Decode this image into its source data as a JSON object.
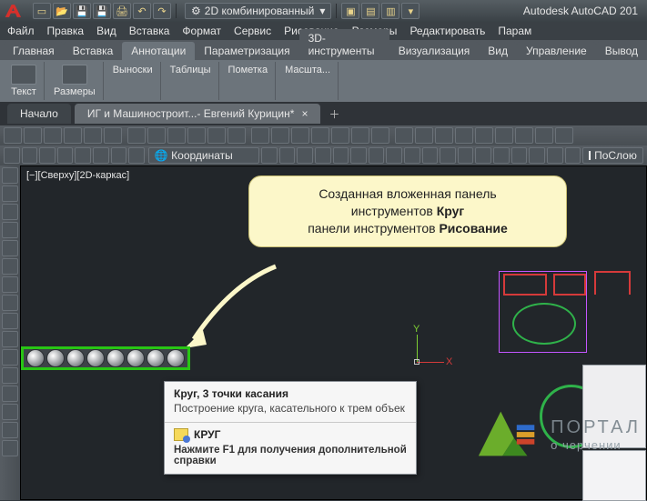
{
  "app_title": "Autodesk AutoCAD 201",
  "workspace_name": "2D комбинированный",
  "menu": [
    "Файл",
    "Правка",
    "Вид",
    "Вставка",
    "Формат",
    "Сервис",
    "Рисование",
    "Размеры",
    "Редактировать",
    "Парам"
  ],
  "ribbon_tabs": [
    "Главная",
    "Вставка",
    "Аннотации",
    "Параметризация",
    "3D-инструменты",
    "Визуализация",
    "Вид",
    "Управление",
    "Вывод"
  ],
  "ribbon_active_index": 2,
  "ribbon_panels": [
    "Текст",
    "Размеры",
    "Выноски",
    "Таблицы",
    "Пометка",
    "Масшта..."
  ],
  "file_tabs": {
    "home": "Начало",
    "doc": "ИГ и Машиностроит...- Евгений Курицин*"
  },
  "coord_label": "Координаты",
  "layer_dropdown": "ПоСлою",
  "view_label": "[−][Сверху][2D-каркас]",
  "axes": {
    "x": "X",
    "y": "Y"
  },
  "callout": {
    "line1": "Созданная вложенная панель",
    "line2_a": "инструментов ",
    "line2_b": "Круг",
    "line3_a": "панели инструментов ",
    "line3_b": "Рисование"
  },
  "tooltip": {
    "title": "Круг, 3 точки касания",
    "desc": "Построение круга, касательного к трем объек",
    "cmd": "КРУГ",
    "f1": "Нажмите F1 для получения дополнительной справки"
  },
  "portal": {
    "l1": "ПОРТАЛ",
    "l2": "о черчении"
  },
  "circle_flyout_count": 8,
  "side_tool_count": 16,
  "toolrow1_btn_count": 28,
  "toolrow2_leading_btns": 8,
  "toolrow2_trailing_btns": 18
}
